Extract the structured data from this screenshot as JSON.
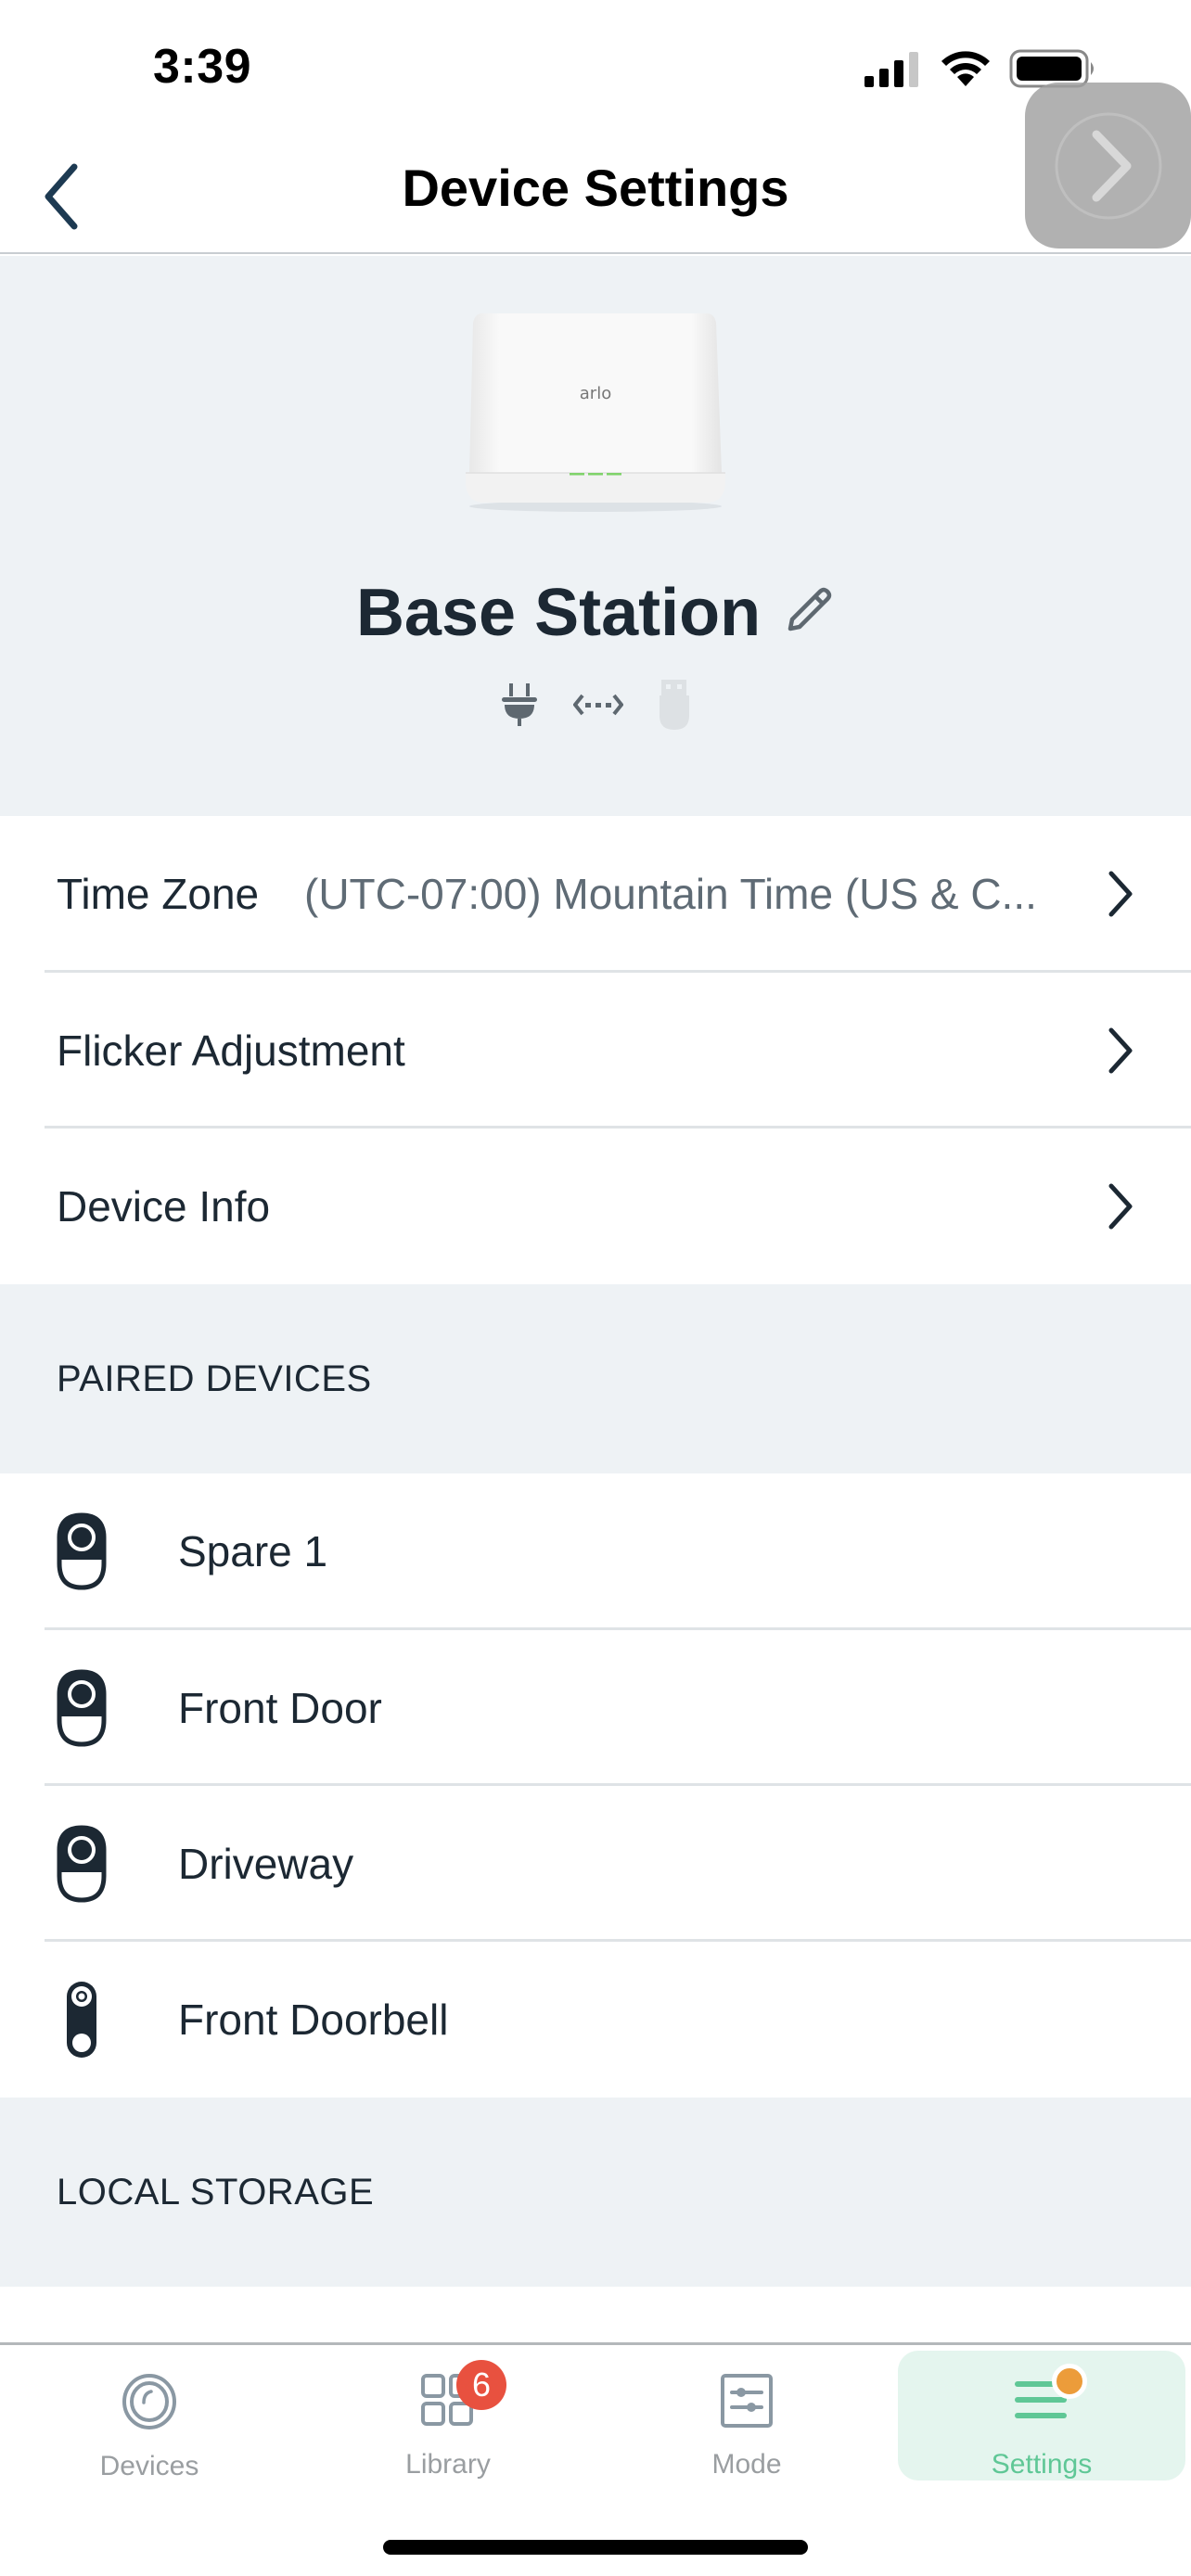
{
  "status_bar": {
    "time": "3:39",
    "signal_icon": "cellular-signal-icon",
    "wifi_icon": "wifi-icon",
    "battery_icon": "battery-icon"
  },
  "nav": {
    "title": "Device Settings",
    "back_icon": "chevron-left-icon",
    "assistive_icon": "chevron-right-circle-icon"
  },
  "device": {
    "name": "Base Station",
    "image_brand": "arlo",
    "edit_icon": "pencil-icon",
    "connection_icons": [
      "power-plug-icon",
      "ethernet-arrows-icon",
      "usb-drive-icon"
    ]
  },
  "settings": [
    {
      "label": "Time Zone",
      "value": "(UTC-07:00) Mountain Time (US & C...",
      "icon": "chevron-right-icon"
    },
    {
      "label": "Flicker Adjustment",
      "value": "",
      "icon": "chevron-right-icon"
    },
    {
      "label": "Device Info",
      "value": "",
      "icon": "chevron-right-icon"
    }
  ],
  "paired_devices": {
    "header": "PAIRED DEVICES",
    "items": [
      {
        "name": "Spare 1",
        "icon": "camera-icon"
      },
      {
        "name": "Front Door",
        "icon": "camera-icon"
      },
      {
        "name": "Driveway",
        "icon": "camera-icon"
      },
      {
        "name": "Front Doorbell",
        "icon": "doorbell-icon"
      }
    ]
  },
  "local_storage": {
    "header": "LOCAL STORAGE"
  },
  "tabbar": {
    "tabs": [
      {
        "label": "Devices",
        "icon": "devices-icon",
        "active": false
      },
      {
        "label": "Library",
        "icon": "library-grid-icon",
        "active": false,
        "badge": "6"
      },
      {
        "label": "Mode",
        "icon": "mode-sliders-icon",
        "active": false
      },
      {
        "label": "Settings",
        "icon": "settings-menu-icon",
        "active": true,
        "notification_dot": true
      }
    ]
  },
  "colors": {
    "accent_green": "#5fc796",
    "badge_red": "#e8513f",
    "notification_orange": "#ec9c3a",
    "text_dark": "#1c2833",
    "section_bg": "#eef2f5"
  }
}
